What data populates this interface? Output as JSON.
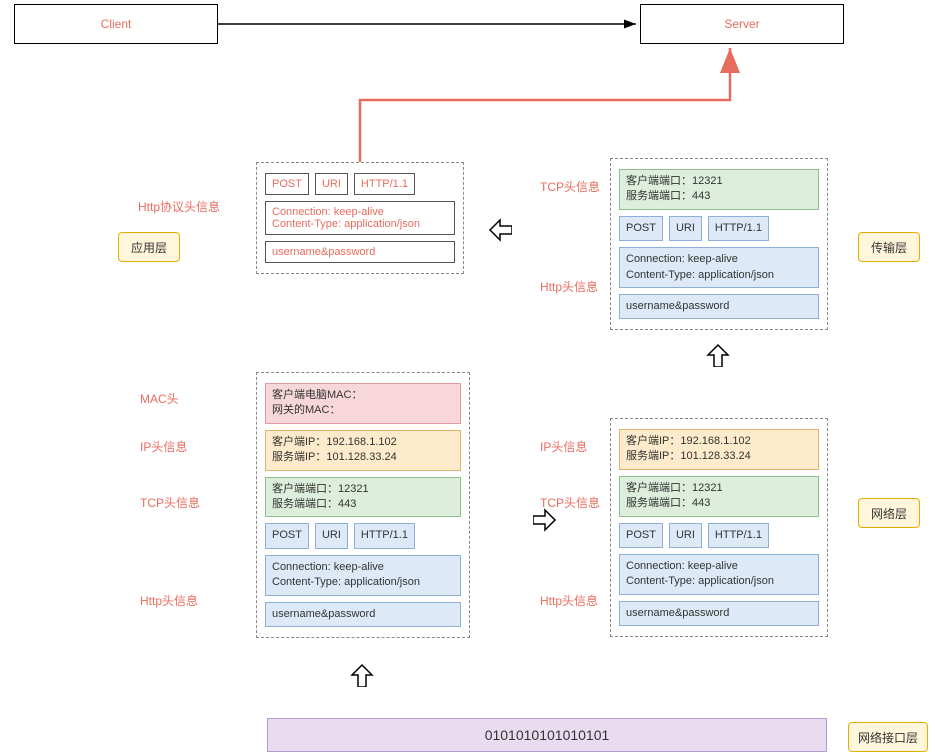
{
  "top": {
    "client": "Client",
    "server": "Server"
  },
  "layer_tags": {
    "app": "应用层",
    "transport": "传输层",
    "network": "网络层",
    "link": "网络接口层"
  },
  "side_labels": {
    "http_proto": "Http协议头信息",
    "tcp": "TCP头信息",
    "http": "Http头信息",
    "mac": "MAC头",
    "ip": "IP头信息"
  },
  "http_line": {
    "method": "POST",
    "uri": "URI",
    "version": "HTTP/1.1"
  },
  "http_headers_line1": "Connection: keep-alive",
  "http_headers_line2": "Content-Type: application/json",
  "http_body": "username&password",
  "tcp_ports_line1": "客户端端口：12321",
  "tcp_ports_line2": "服务端端口：443",
  "ip_lines_line1": "客户端IP：192.168.1.102",
  "ip_lines_line2": "服务端IP：101.128.33.24",
  "mac_lines_line1": "客户端电脑MAC：",
  "mac_lines_line2": "网关的MAC：",
  "bits": "0101010101010101"
}
